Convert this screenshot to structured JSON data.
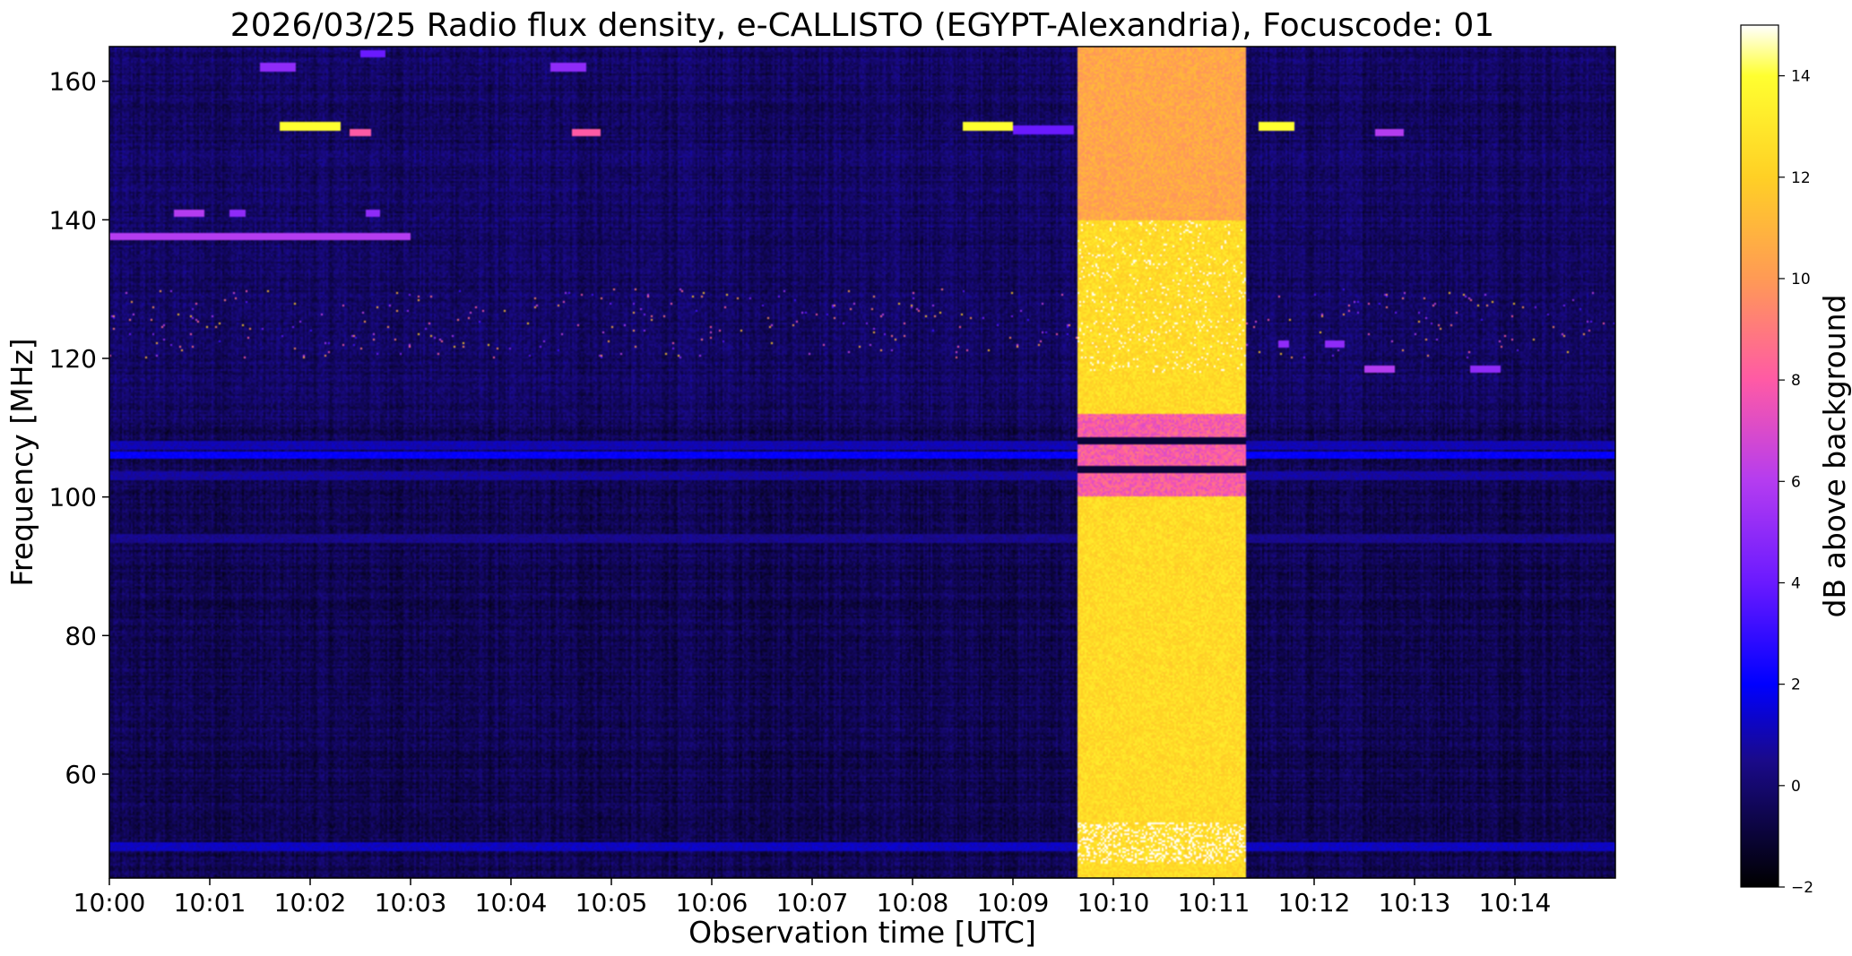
{
  "chart_data": {
    "type": "heatmap",
    "title": "2026/03/25  Radio flux density, e-CALLISTO (EGYPT-Alexandria), Focuscode: 01",
    "xlabel": "Observation time [UTC]",
    "ylabel": "Frequency [MHz]",
    "x_ticks": [
      "10:00",
      "10:01",
      "10:02",
      "10:03",
      "10:04",
      "10:05",
      "10:06",
      "10:07",
      "10:08",
      "10:09",
      "10:10",
      "10:11",
      "10:12",
      "10:13",
      "10:14"
    ],
    "x_range_minutes": [
      0,
      15
    ],
    "y_ticks": [
      60,
      80,
      100,
      120,
      140,
      160
    ],
    "ylim": [
      45,
      165
    ],
    "colorbar": {
      "label": "dB above background",
      "range": [
        -2,
        15
      ],
      "ticks": [
        -2,
        0,
        2,
        4,
        6,
        8,
        10,
        12,
        14
      ],
      "colormap": "gnuplot2",
      "stops": [
        {
          "value": -2,
          "color": "#000000"
        },
        {
          "value": 0.5,
          "color": "#1a0a8a"
        },
        {
          "value": 2,
          "color": "#0000ff"
        },
        {
          "value": 4,
          "color": "#6a1aff"
        },
        {
          "value": 6,
          "color": "#b43cf0"
        },
        {
          "value": 8,
          "color": "#ff5aa5"
        },
        {
          "value": 10,
          "color": "#ff9a55"
        },
        {
          "value": 12,
          "color": "#ffd025"
        },
        {
          "value": 14,
          "color": "#ffff30"
        },
        {
          "value": 15,
          "color": "#ffffff"
        }
      ]
    },
    "background_level_db": -0.5,
    "bursts": [
      {
        "name": "broadband burst",
        "t_start": 9.65,
        "t_end": 11.32,
        "f_min": 45,
        "f_max": 165,
        "level_db": 12.5
      }
    ],
    "continuous_bands": [
      {
        "f": 106,
        "level_db": 2.0
      },
      {
        "f": 107.5,
        "level_db": 1.0
      },
      {
        "f": 103,
        "level_db": 0.8
      },
      {
        "f": 49.5,
        "level_db": 1.2
      },
      {
        "f": 94,
        "level_db": 0.5
      }
    ],
    "line_segments": [
      {
        "f": 137.5,
        "t_start": 0.0,
        "t_end": 3.0,
        "level_db": 6
      },
      {
        "f": 153.5,
        "t_start": 1.7,
        "t_end": 2.3,
        "level_db": 14
      },
      {
        "f": 153.5,
        "t_start": 8.5,
        "t_end": 9.0,
        "level_db": 14
      },
      {
        "f": 153.0,
        "t_start": 9.0,
        "t_end": 9.6,
        "level_db": 4
      },
      {
        "f": 153.5,
        "t_start": 11.45,
        "t_end": 11.8,
        "level_db": 14
      },
      {
        "f": 141,
        "t_start": 0.65,
        "t_end": 0.95,
        "level_db": 6
      },
      {
        "f": 141,
        "t_start": 1.2,
        "t_end": 1.35,
        "level_db": 5
      },
      {
        "f": 141,
        "t_start": 2.55,
        "t_end": 2.7,
        "level_db": 5
      },
      {
        "f": 152.5,
        "t_start": 2.4,
        "t_end": 2.6,
        "level_db": 8
      },
      {
        "f": 152.5,
        "t_start": 4.6,
        "t_end": 4.9,
        "level_db": 8
      },
      {
        "f": 162,
        "t_start": 1.5,
        "t_end": 1.85,
        "level_db": 5
      },
      {
        "f": 162,
        "t_start": 4.4,
        "t_end": 4.75,
        "level_db": 5
      },
      {
        "f": 164,
        "t_start": 2.5,
        "t_end": 2.75,
        "level_db": 4
      },
      {
        "f": 152.5,
        "t_start": 12.6,
        "t_end": 12.9,
        "level_db": 6
      },
      {
        "f": 118.5,
        "t_start": 12.5,
        "t_end": 12.8,
        "level_db": 6
      },
      {
        "f": 118.5,
        "t_start": 13.55,
        "t_end": 13.85,
        "level_db": 5
      },
      {
        "f": 122,
        "t_start": 11.65,
        "t_end": 11.75,
        "level_db": 5
      },
      {
        "f": 122,
        "t_start": 12.1,
        "t_end": 12.3,
        "level_db": 5
      }
    ]
  }
}
